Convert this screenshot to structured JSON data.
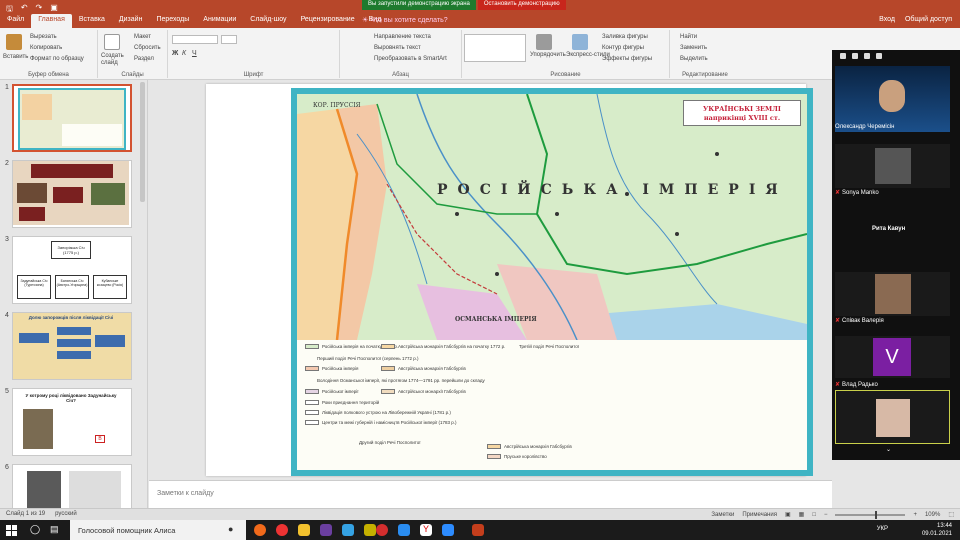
{
  "menubar": {
    "tabs": [
      "Файл",
      "Главная",
      "Вставка",
      "Дизайн",
      "Переходы",
      "Анимации",
      "Слайд-шоу",
      "Рецензирование",
      "Вид"
    ],
    "active_tab": "Главная",
    "tell_me": "Что вы хотите сделать?",
    "signin": "Вход",
    "share": "Общий доступ"
  },
  "share_banner": {
    "message": "Вы запустили демонстрацию экрана",
    "stop": "Остановить демонстрацию"
  },
  "ribbon": {
    "clipboard": {
      "label": "Буфер обмена",
      "paste": "Вставить",
      "cut": "Вырезать",
      "copy": "Копировать",
      "format": "Формат по образцу"
    },
    "slides": {
      "label": "Слайды",
      "new_slide": "Создать слайд",
      "layout": "Макет",
      "reset": "Сбросить",
      "section": "Раздел"
    },
    "font": {
      "label": "Шрифт"
    },
    "paragraph": {
      "label": "Абзац",
      "direction": "Направление текста",
      "align": "Выровнять текст",
      "smartart": "Преобразовать в SmartArt"
    },
    "drawing": {
      "label": "Рисование",
      "arrange": "Упорядочить",
      "styles": "Экспресс-стили",
      "fill": "Заливка фигуры",
      "outline": "Контур фигуры",
      "effects": "Эффекты фигуры"
    },
    "editing": {
      "label": "Редактирование",
      "find": "Найти",
      "replace": "Заменить",
      "select": "Выделить"
    }
  },
  "thumbnails": [
    {
      "num": "1"
    },
    {
      "num": "2"
    },
    {
      "num": "3",
      "title": "Запорізька Січ (1775 р.)",
      "children": [
        "Задунайська Січ (Туреччина)",
        "Банатська Січ (Австро-Угорщина)",
        "Кубанське козацтво (Росія)"
      ]
    },
    {
      "num": "4",
      "title": "Долю запорожців після ліквідації Січі"
    },
    {
      "num": "5",
      "title": "У котрому році ліквідовано Задунайську Січ?"
    },
    {
      "num": "6"
    }
  ],
  "slide": {
    "map_title": "УКРАЇНСЬКІ ЗЕМЛІ наприкінці XVIII ст.",
    "empire_label": "РОСІЙСЬКА ІМПЕРІЯ",
    "prussia_label": "КОР. ПРУССІЯ",
    "ottoman_label": "ОСМАНСЬКА ІМПЕРІЯ",
    "legend": [
      "Російська імперія на початку 1772 р.",
      "Австрійська монархія Габсбургів на початку 1772 р.",
      "Перший поділ Речі Посполитої (серпень 1772 р.)",
      "Російська імперія",
      "Австрійська монархія Габсбургів",
      "Володіння Османської імперії, які протягом 1774—1791 рр. перейшли до складу",
      "Російської імперії",
      "Австрійської монархії Габсбургів",
      "Роки приєднання територій",
      "Ліквідація полкового устрою на Лівобережній Україні (1781 р.)",
      "Центри та межі губерній і намісництв Російської імперії (1783 р.)",
      "Другий поділ Речі Посполитої",
      "Третій поділ Речі Посполитої",
      "Пруське королівство",
      "Австрійська монархія Габсбургів"
    ]
  },
  "notes": "Заметки к слайду",
  "video_panel": {
    "participants": [
      "Олександр Черемісін",
      "Sonya Manko",
      "Рита Кавун",
      "Співак Валерія",
      "Влад Радько"
    ],
    "avatar_letter": "V"
  },
  "status": {
    "slide_of": "Слайд 1 из 19",
    "language": "русский",
    "notes_btn": "Заметки",
    "comments_btn": "Примечания",
    "zoom": "109%"
  },
  "taskbar": {
    "search": "Голосовой помощник Алиса",
    "lang": "УКР",
    "time": "13:44",
    "date": "09.01.2021"
  },
  "colors": {
    "accent": "#b7472a",
    "map_border": "#3fb4c4",
    "russia": "#d7ecc9",
    "austria": "#f6d7a3",
    "ottoman": "#e7bfe0"
  }
}
